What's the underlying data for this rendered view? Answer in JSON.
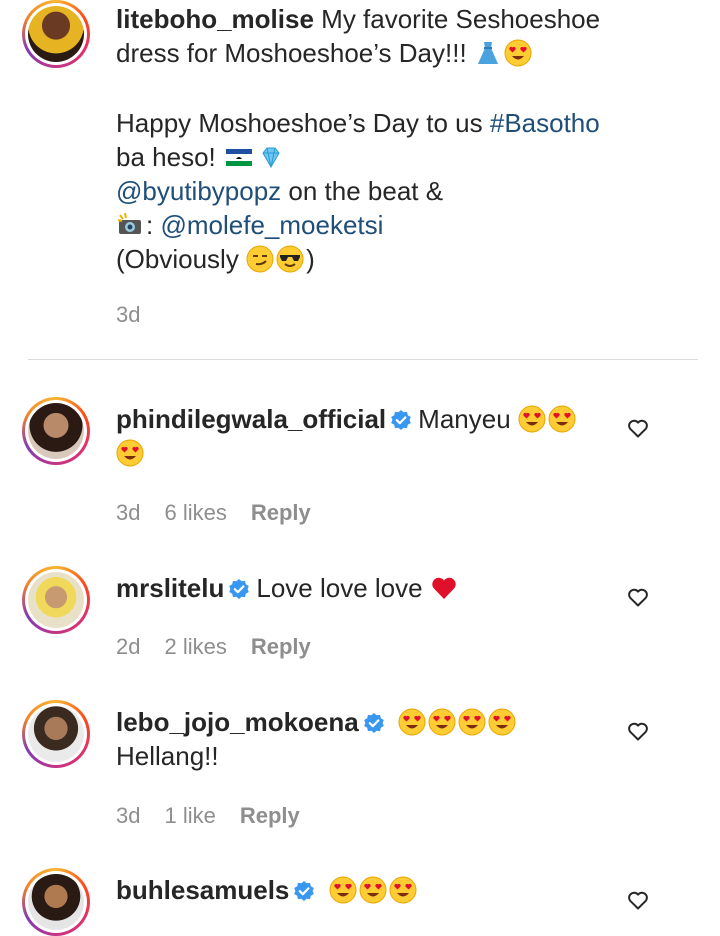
{
  "post": {
    "username": "liteboho_molise",
    "caption_1": "My favorite Seshoeshoe",
    "caption_2": "dress for Moshoeshoe’s Day!!!",
    "caption_3": "Happy Moshoeshoe’s Day to us",
    "hashtag": "#Basotho",
    "caption_4": "ba heso!",
    "mention_1": "@byutibypopz",
    "caption_5": "on the beat &",
    "camera_suffix": ":",
    "mention_2": "@molefe_moeketsi",
    "caption_6_open": "(Obviously",
    "caption_6_close": ")",
    "time": "3d"
  },
  "comments": [
    {
      "username": "phindilegwala_official",
      "verified": true,
      "text": "Manyeu",
      "time": "3d",
      "likes": "6 likes",
      "reply": "Reply"
    },
    {
      "username": "mrslitelu",
      "verified": true,
      "text": "Love love love",
      "time": "2d",
      "likes": "2 likes",
      "reply": "Reply"
    },
    {
      "username": "lebo_jojo_mokoena",
      "verified": true,
      "text": "Hellang!!",
      "time": "3d",
      "likes": "1 like",
      "reply": "Reply"
    },
    {
      "username": "buhlesamuels",
      "verified": true,
      "text": ""
    }
  ],
  "icons": {
    "verified": "verified-badge-icon",
    "like": "heart-outline-icon"
  },
  "colors": {
    "verified": "#3897f0",
    "link": "#1f4e79",
    "meta": "#8e8e8e",
    "heart": "#e0102b"
  }
}
